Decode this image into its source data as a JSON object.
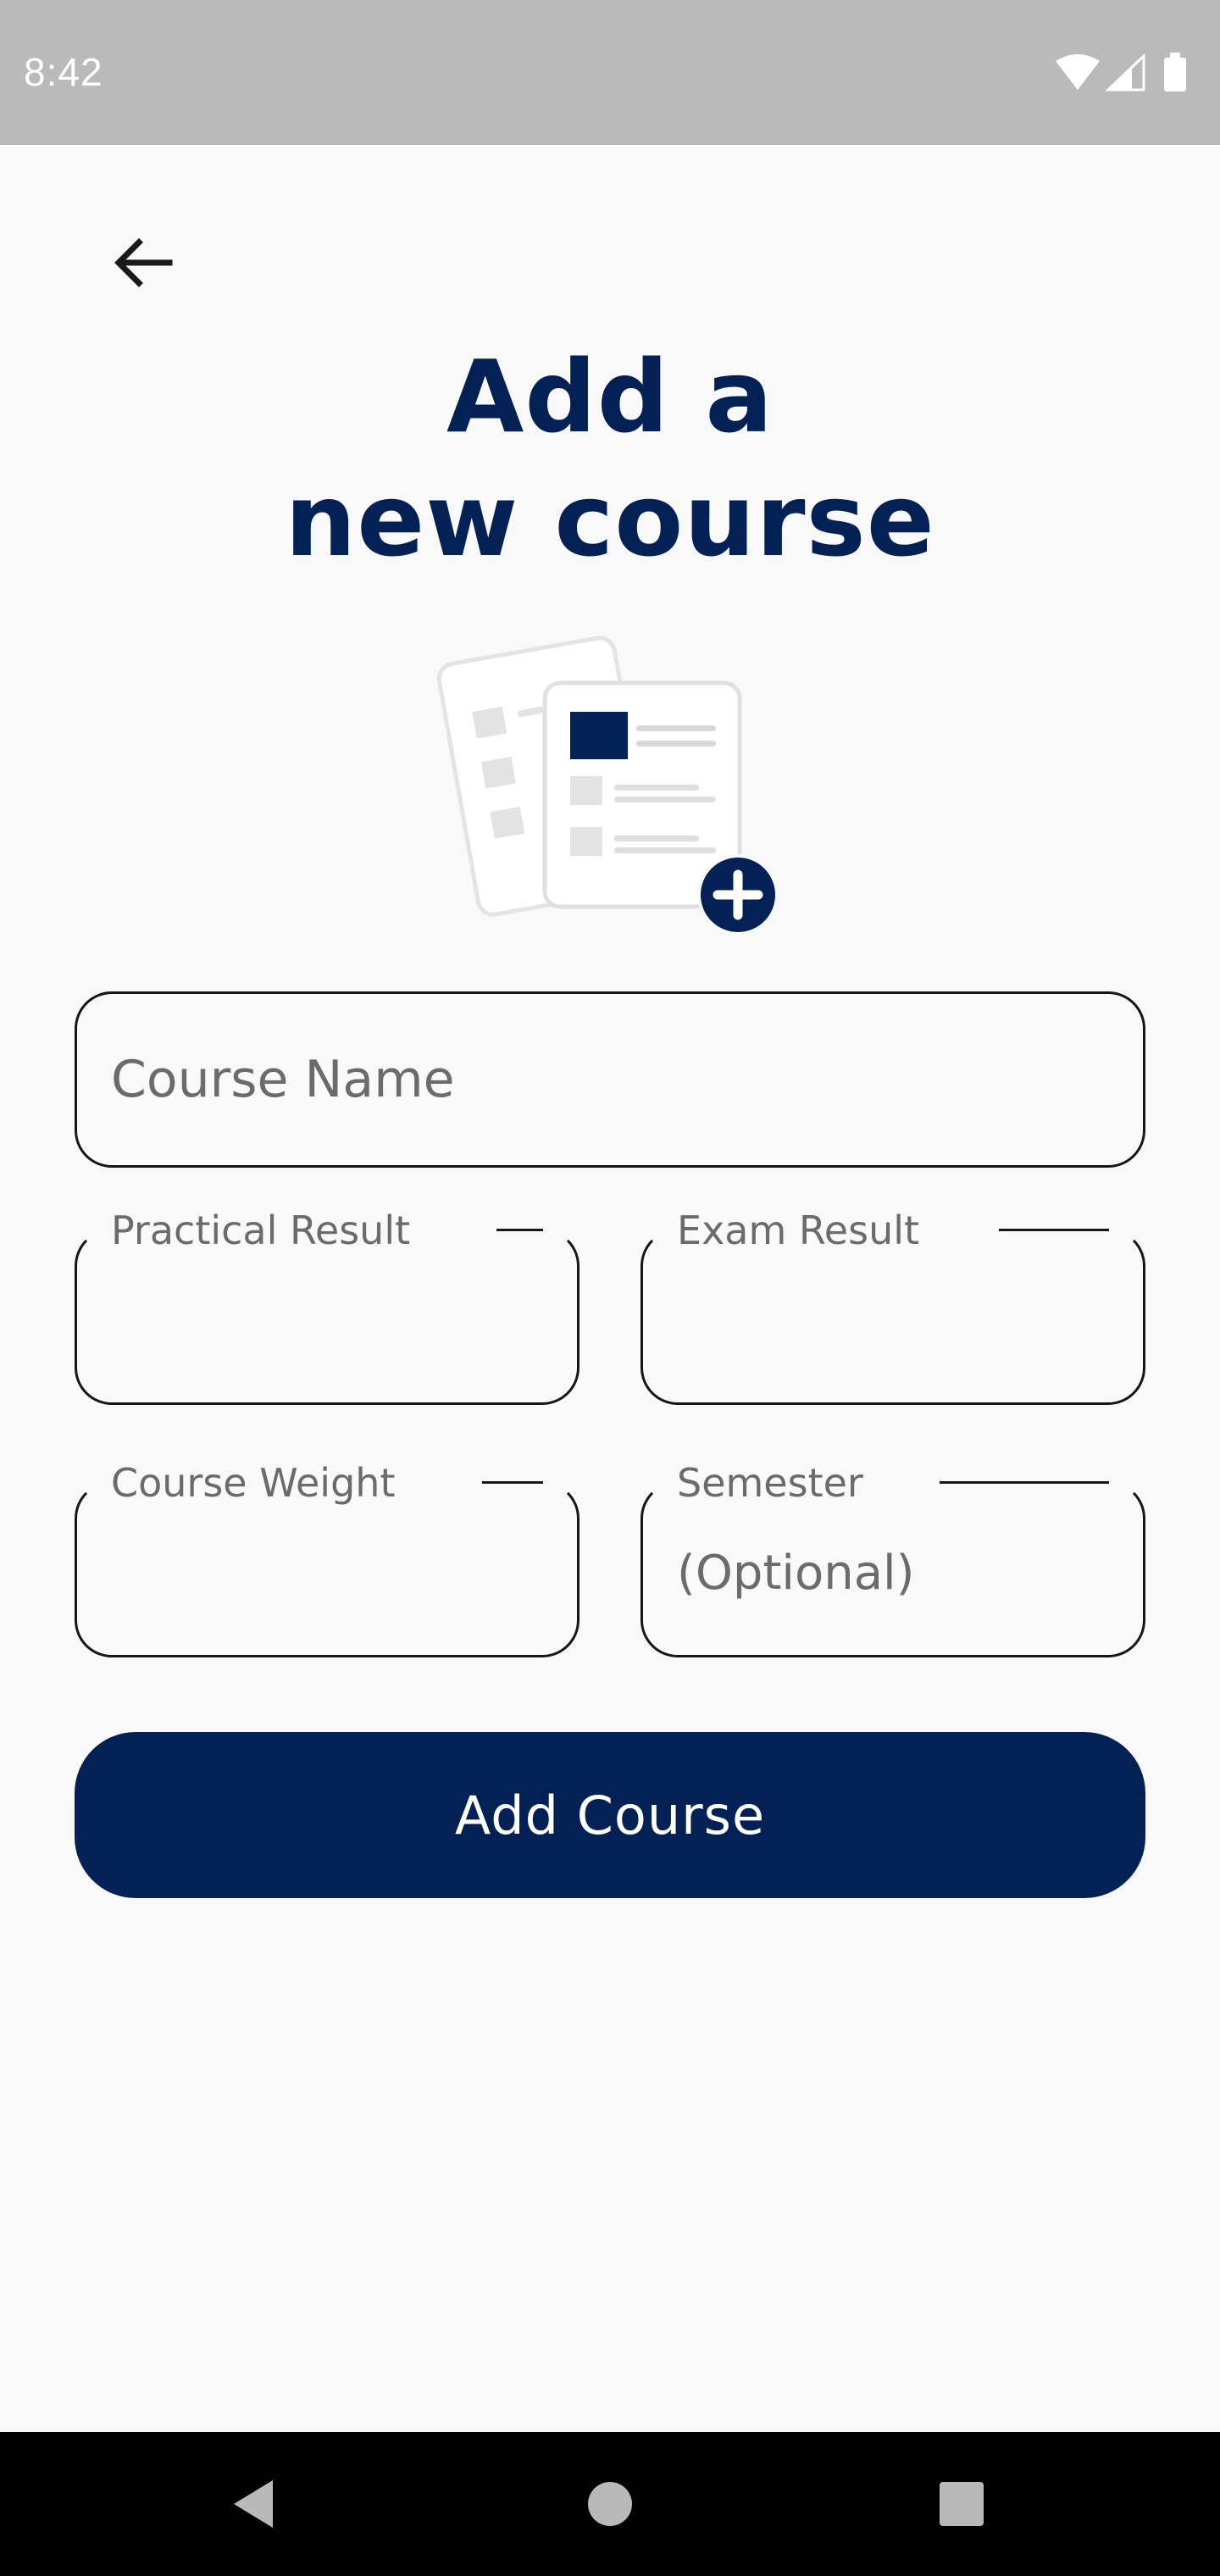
{
  "status_bar": {
    "time": "8:42",
    "icons": [
      "wifi-icon",
      "cell-signal-icon",
      "battery-icon"
    ]
  },
  "header": {
    "back_icon": "arrow-left-icon",
    "title_line1": "Add a",
    "title_line2": "new course"
  },
  "illustration": {
    "icon": "add-document-icon"
  },
  "form": {
    "course_name": {
      "placeholder": "Course Name",
      "value": ""
    },
    "practical_result": {
      "label": "Practical Result",
      "value": ""
    },
    "exam_result": {
      "label": "Exam Result",
      "value": ""
    },
    "course_weight": {
      "label": "Course Weight",
      "value": ""
    },
    "semester": {
      "label": "Semester",
      "placeholder": "(Optional)",
      "value": ""
    }
  },
  "actions": {
    "add_course_label": "Add Course"
  },
  "nav_bar": {
    "icons": [
      "nav-back-icon",
      "nav-home-icon",
      "nav-recents-icon"
    ]
  },
  "colors": {
    "primary": "#032155",
    "background": "#f9f9fa",
    "status_bar": "#bababa",
    "label_gray": "#6b6b6b"
  }
}
